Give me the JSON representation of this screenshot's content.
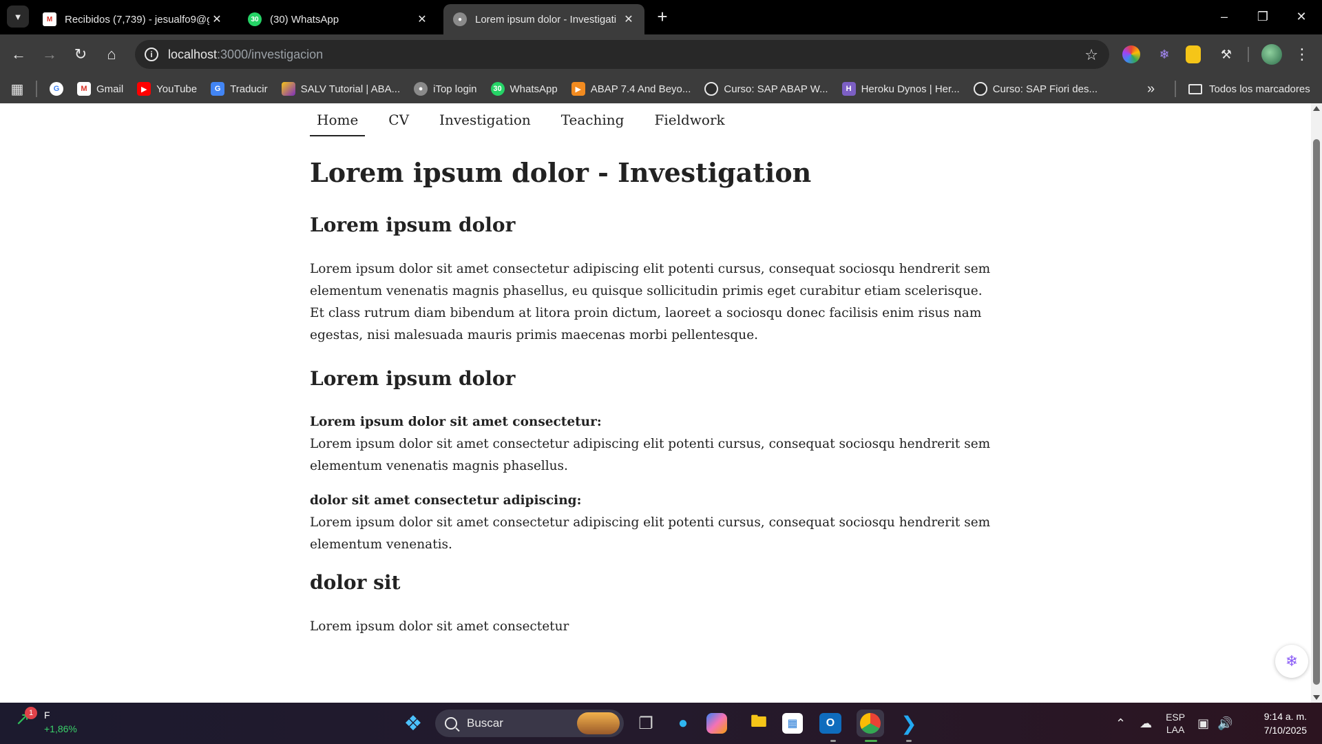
{
  "browser": {
    "tabs": [
      {
        "title": "Recibidos (7,739) - jesualfo9@g",
        "favicon": "gmail-icon",
        "active": false
      },
      {
        "title": "(30) WhatsApp",
        "favicon": "whatsapp-icon",
        "active": false,
        "badge": "30"
      },
      {
        "title": "Lorem ipsum dolor - Investigati",
        "favicon": "globe-icon",
        "active": true
      }
    ],
    "url_host": "localhost",
    "url_path": ":3000/investigacion",
    "bookmarks": [
      {
        "label": "",
        "icon": "google-icon"
      },
      {
        "label": "Gmail",
        "icon": "gmail-icon"
      },
      {
        "label": "YouTube",
        "icon": "youtube-icon"
      },
      {
        "label": "Traducir",
        "icon": "translate-icon"
      },
      {
        "label": "SALV Tutorial | ABA...",
        "icon": "salv-icon"
      },
      {
        "label": "iTop login",
        "icon": "globe-icon"
      },
      {
        "label": "WhatsApp",
        "icon": "whatsapp-icon",
        "badge": "30"
      },
      {
        "label": "ABAP 7.4 And Beyo...",
        "icon": "abap-icon"
      },
      {
        "label": "Curso: SAP ABAP W...",
        "icon": "udemy-icon"
      },
      {
        "label": "Heroku Dynos | Her...",
        "icon": "heroku-icon"
      },
      {
        "label": "Curso: SAP Fiori des...",
        "icon": "udemy-icon"
      }
    ],
    "all_bookmarks_label": "Todos los marcadores"
  },
  "site": {
    "nav": [
      {
        "label": "Home",
        "active": true
      },
      {
        "label": "CV",
        "active": false
      },
      {
        "label": "Investigation",
        "active": false
      },
      {
        "label": "Teaching",
        "active": false
      },
      {
        "label": "Fieldwork",
        "active": false
      }
    ],
    "page_title": "Lorem ipsum dolor - Investigation",
    "section1": {
      "heading": "Lorem ipsum dolor",
      "paragraph": "Lorem ipsum dolor sit amet consectetur adipiscing elit potenti cursus, consequat sociosqu hendrerit sem elementum venenatis magnis phasellus, eu quisque sollicitudin primis eget curabitur etiam scelerisque. Et class rutrum diam bibendum at litora proin dictum, laoreet a sociosqu donec facilisis enim risus nam egestas, nisi malesuada mauris primis maecenas morbi pellentesque."
    },
    "section2": {
      "heading": "Lorem ipsum dolor",
      "items": [
        {
          "title": "Lorem ipsum dolor sit amet consectetur:",
          "text": "Lorem ipsum dolor sit amet consectetur adipiscing elit potenti cursus, consequat sociosqu hendrerit sem elementum venenatis magnis phasellus."
        },
        {
          "title": "dolor sit amet consectetur adipiscing:",
          "text": "Lorem ipsum dolor sit amet consectetur adipiscing elit potenti cursus, consequat sociosqu hendrerit sem elementum venenatis."
        }
      ]
    },
    "section3": {
      "heading": "dolor sit",
      "paragraph": "Lorem ipsum dolor sit amet consectetur"
    }
  },
  "taskbar": {
    "stock_badge": "1",
    "stock_symbol": "F",
    "stock_change": "+1,86%",
    "search_label": "Buscar",
    "language_line1": "ESP",
    "language_line2": "LAA",
    "time": "9:14 a. m.",
    "date": "7/10/2025"
  },
  "colors": {
    "chrome_dark": "#000000",
    "chrome_toolbar": "#3c3c3c",
    "page_bg": "#ffffff",
    "text": "#222222"
  }
}
